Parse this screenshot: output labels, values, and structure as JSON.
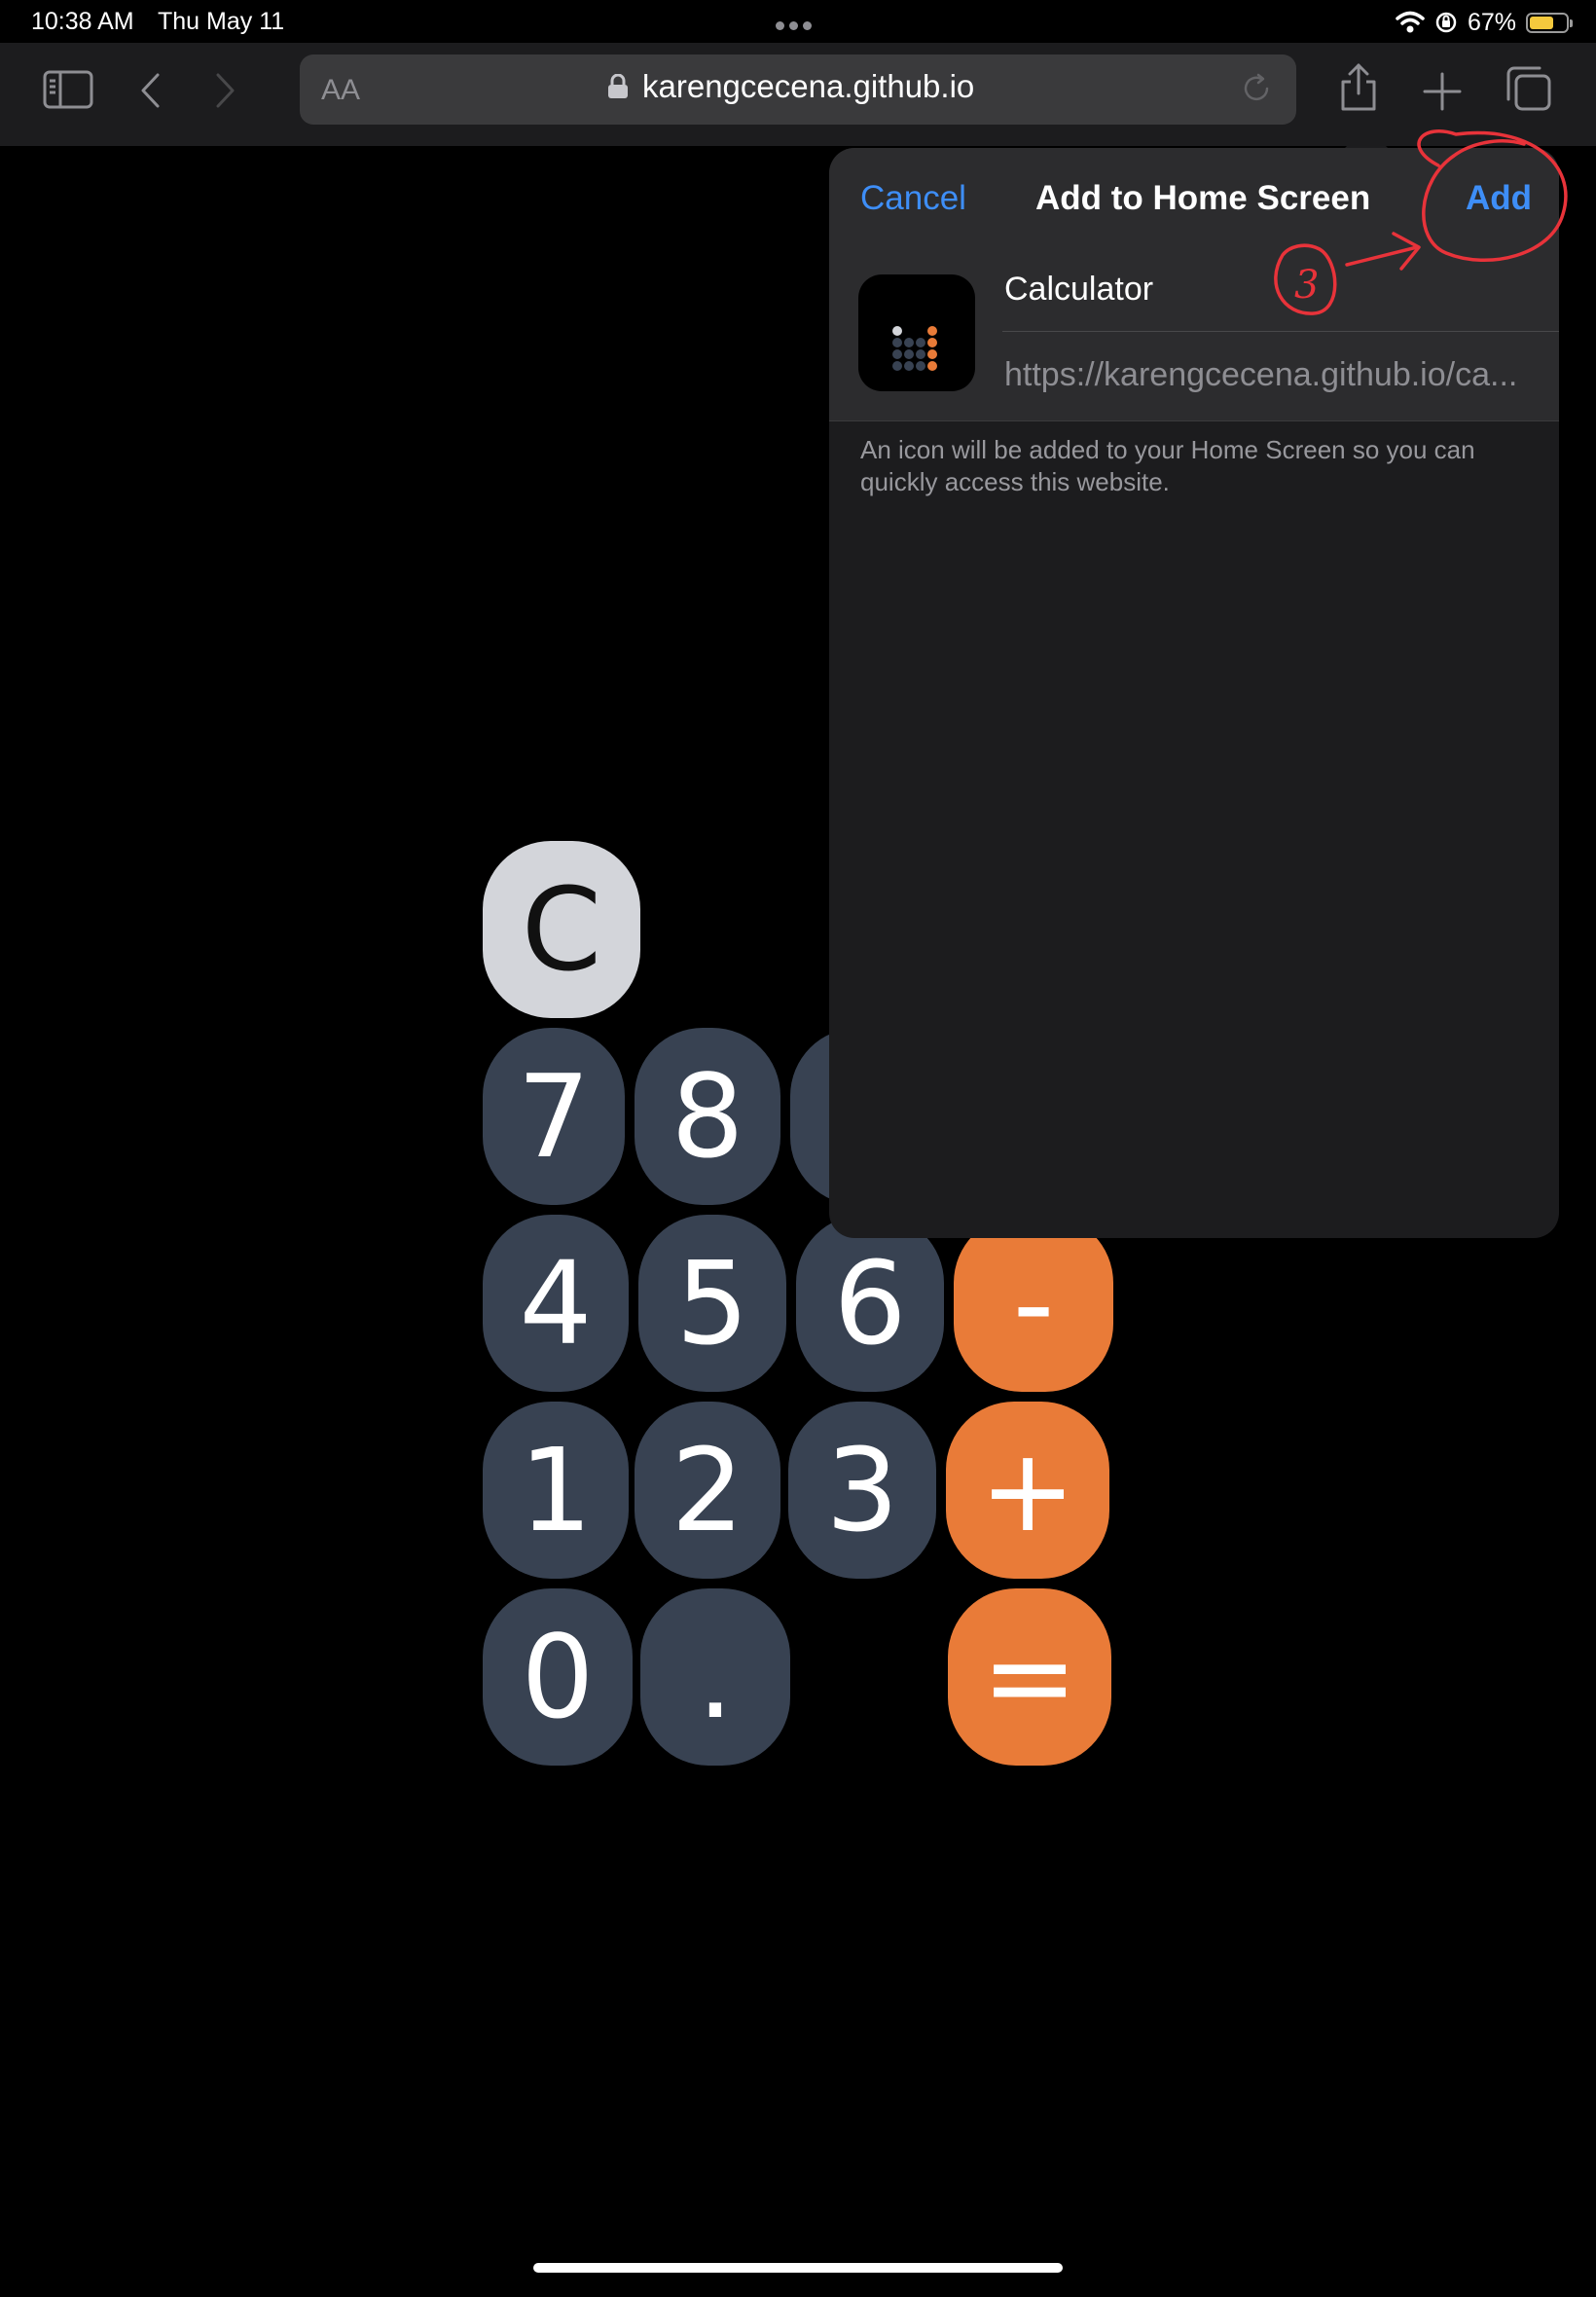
{
  "status_bar": {
    "time": "10:38 AM",
    "date": "Thu May 11",
    "battery": "67%",
    "battery_level": 0.67,
    "accent_battery": "#f5c93d"
  },
  "toolbar": {
    "text_size_button": "AA",
    "address": "karengcecena.github.io"
  },
  "calculator": {
    "clear": "C",
    "keys_row1": [
      "7",
      "8"
    ],
    "keys_row2": [
      "4",
      "5",
      "6",
      "-"
    ],
    "keys_row3": [
      "1",
      "2",
      "3",
      "+"
    ],
    "keys_row4": [
      "0",
      ".",
      "="
    ],
    "colors": {
      "number_key": "#384252",
      "operator_key": "#e97b38",
      "clear_key": "#d3d5da"
    }
  },
  "dialog": {
    "cancel": "Cancel",
    "title": "Add to Home Screen",
    "add": "Add",
    "app_name": "Calculator",
    "app_url": "https://karengcecena.github.io/ca...",
    "hint": "An icon will be added to your Home Screen so you can quickly access this website.",
    "accent": "#3e8ef7"
  },
  "annotation": {
    "step_number": "3",
    "color": "#e8333a"
  }
}
